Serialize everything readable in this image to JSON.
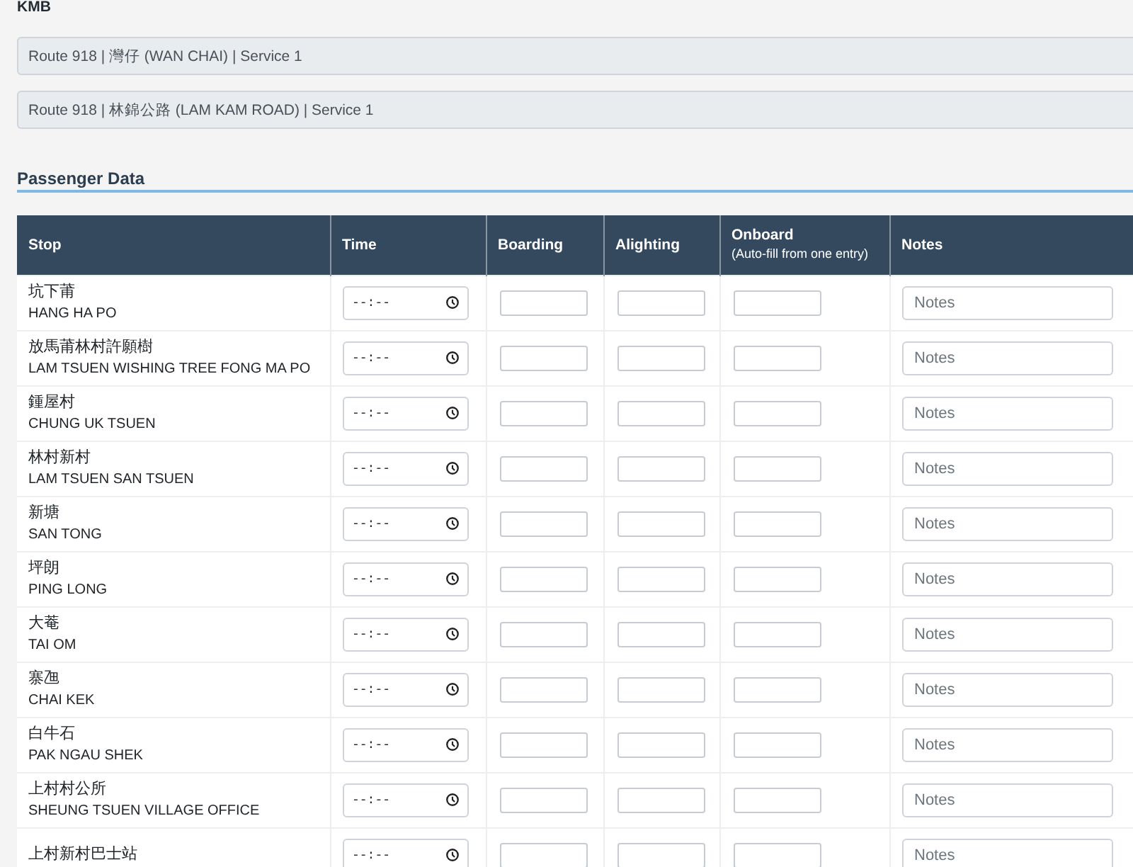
{
  "operator": "KMB",
  "routes": [
    {
      "label": "Route 918 | 灣仔 (WAN CHAI) | Service 1",
      "disabled": true
    },
    {
      "label": "Route 918 | 林錦公路 (LAM KAM ROAD) | Service 1",
      "disabled": true
    }
  ],
  "section_title": "Passenger Data",
  "table": {
    "columns": [
      {
        "label": "Stop"
      },
      {
        "label": "Time"
      },
      {
        "label": "Boarding"
      },
      {
        "label": "Alighting"
      },
      {
        "label": "Onboard",
        "note": "(Auto-fill from one entry)"
      },
      {
        "label": "Notes"
      }
    ],
    "rows": [
      {
        "name_zh": "坑下莆",
        "name_en": "HANG HA PO",
        "time_placeholder": "--:--",
        "notes_placeholder": "Notes"
      },
      {
        "name_zh": "放馬莆林村許願樹",
        "name_en": "LAM TSUEN WISHING TREE FONG MA PO",
        "time_placeholder": "--:--",
        "notes_placeholder": "Notes"
      },
      {
        "name_zh": "鍾屋村",
        "name_en": "CHUNG UK TSUEN",
        "time_placeholder": "--:--",
        "notes_placeholder": "Notes"
      },
      {
        "name_zh": "林村新村",
        "name_en": "LAM TSUEN SAN TSUEN",
        "time_placeholder": "--:--",
        "notes_placeholder": "Notes"
      },
      {
        "name_zh": "新塘",
        "name_en": "SAN TONG",
        "time_placeholder": "--:--",
        "notes_placeholder": "Notes"
      },
      {
        "name_zh": "坪朗",
        "name_en": "PING LONG",
        "time_placeholder": "--:--",
        "notes_placeholder": "Notes"
      },
      {
        "name_zh": "大菴",
        "name_en": "TAI OM",
        "time_placeholder": "--:--",
        "notes_placeholder": "Notes"
      },
      {
        "name_zh": "寨乪",
        "name_en": "CHAI KEK",
        "time_placeholder": "--:--",
        "notes_placeholder": "Notes"
      },
      {
        "name_zh": "白牛石",
        "name_en": "PAK NGAU SHEK",
        "time_placeholder": "--:--",
        "notes_placeholder": "Notes"
      },
      {
        "name_zh": "上村村公所",
        "name_en": "SHEUNG TSUEN VILLAGE OFFICE",
        "time_placeholder": "--:--",
        "notes_placeholder": "Notes"
      },
      {
        "name_zh": "上村新村巴士站",
        "time_placeholder": "--:--",
        "notes_placeholder": "Notes"
      }
    ]
  }
}
